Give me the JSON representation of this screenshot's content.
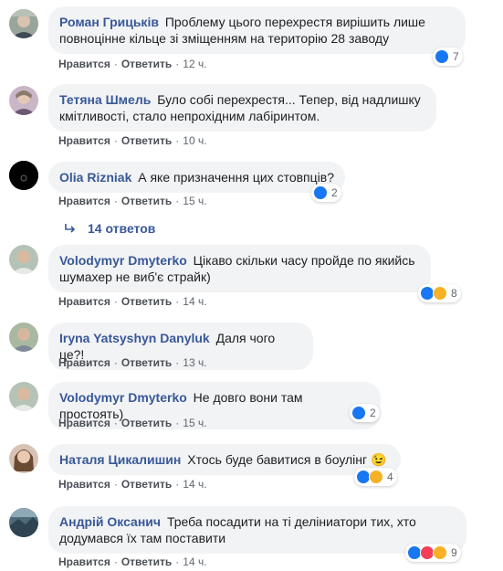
{
  "labels": {
    "like": "Нравится",
    "reply": "Ответить"
  },
  "comments": [
    {
      "author": "Роман Грицьків",
      "text": "Проблему цього перехрестя вирішить лише повноцінне кільце зі зміщенням на територію 28 заводу",
      "time": "12 ч.",
      "reactions": [
        "like"
      ],
      "count": "7"
    },
    {
      "author": "Тетяна Шмель",
      "text": "Було собі перехрестя... Тепер, від надлишку кмітливості, стало непрохідним лабіринтом.",
      "time": "10 ч.",
      "reactions": [],
      "count": ""
    },
    {
      "author": "Olia Rizniak",
      "text": "А яке призначення цих стовпців?",
      "time": "15 ч.",
      "reactions": [
        "like"
      ],
      "count": "2"
    },
    {
      "author": "Volodymyr Dmyterko",
      "text": "Цікаво скільки часу пройде по якийсь шумахер не виб'є страйк)",
      "time": "14 ч.",
      "reactions": [
        "like",
        "haha"
      ],
      "count": "8"
    },
    {
      "author": "Iryna Yatsyshyn Danyluk",
      "text": "Даля чого це?!",
      "time": "13 ч.",
      "reactions": [],
      "count": ""
    },
    {
      "author": "Volodymyr Dmyterko",
      "text": "Не довго вони там простоять)",
      "time": "15 ч.",
      "reactions": [
        "like"
      ],
      "count": "2"
    },
    {
      "author": "Наталя Цикалишин",
      "text": "Хтось буде бавитися в боулінг 😉",
      "time": "14 ч.",
      "reactions": [
        "like",
        "haha"
      ],
      "count": "4"
    },
    {
      "author": "Андрій Оксанич",
      "text": "Треба посадити на ті деліниатори тих, хто додумався їх там поставити",
      "time": "14 ч.",
      "reactions": [
        "like",
        "love",
        "haha"
      ],
      "count": "9"
    }
  ],
  "replies": {
    "label": "14 ответов"
  },
  "avatar_text": {
    "olia": "Memories"
  }
}
